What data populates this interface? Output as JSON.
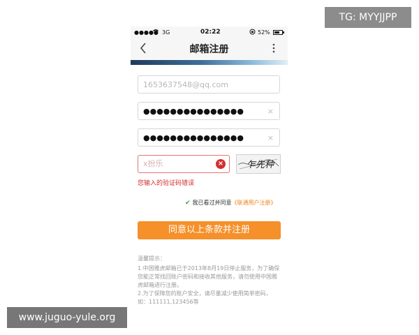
{
  "watermarks": {
    "tg": "TG: MYYJJPP",
    "url": "www.juguo-yule.org"
  },
  "status_bar": {
    "signal": "●●●●●",
    "carrier": "3G",
    "time": "02:22",
    "battery": "52%",
    "battery_level": 0.52
  },
  "nav": {
    "back_icon": "chevron-left",
    "title": "邮箱注册",
    "more_icon": "vertical-ellipsis"
  },
  "form": {
    "email_value": "1653637548@qq.com",
    "password_value": "●●●●●●●●●●●●●●●",
    "confirm_password_value": "●●●●●●●●●●●●●●●",
    "clear_symbol": "×",
    "captcha_value": "x扮乐",
    "captcha_image_text": "乍先种",
    "captcha_error": "您输入的验证码错误"
  },
  "agreement": {
    "checked": true,
    "text": "我已看过并同意",
    "link": "《联通用户注册》"
  },
  "submit_label": "同意以上条款并注册",
  "tips": {
    "title": "温馨提示：",
    "line1": "1.中国雅虎邮箱已于2013年8月19日停止服务，为了确保您能正常找回账户密码和接收其他服务，请勿使用中国雅虎邮箱进行注册。",
    "line2": "2.为了保障您的账户安全，请尽量减少使用简单密码，如：111111,123456等"
  },
  "colors": {
    "accent": "#f5902a",
    "error": "#d32f2f",
    "check": "#3aa33a",
    "link": "#f0841f"
  }
}
